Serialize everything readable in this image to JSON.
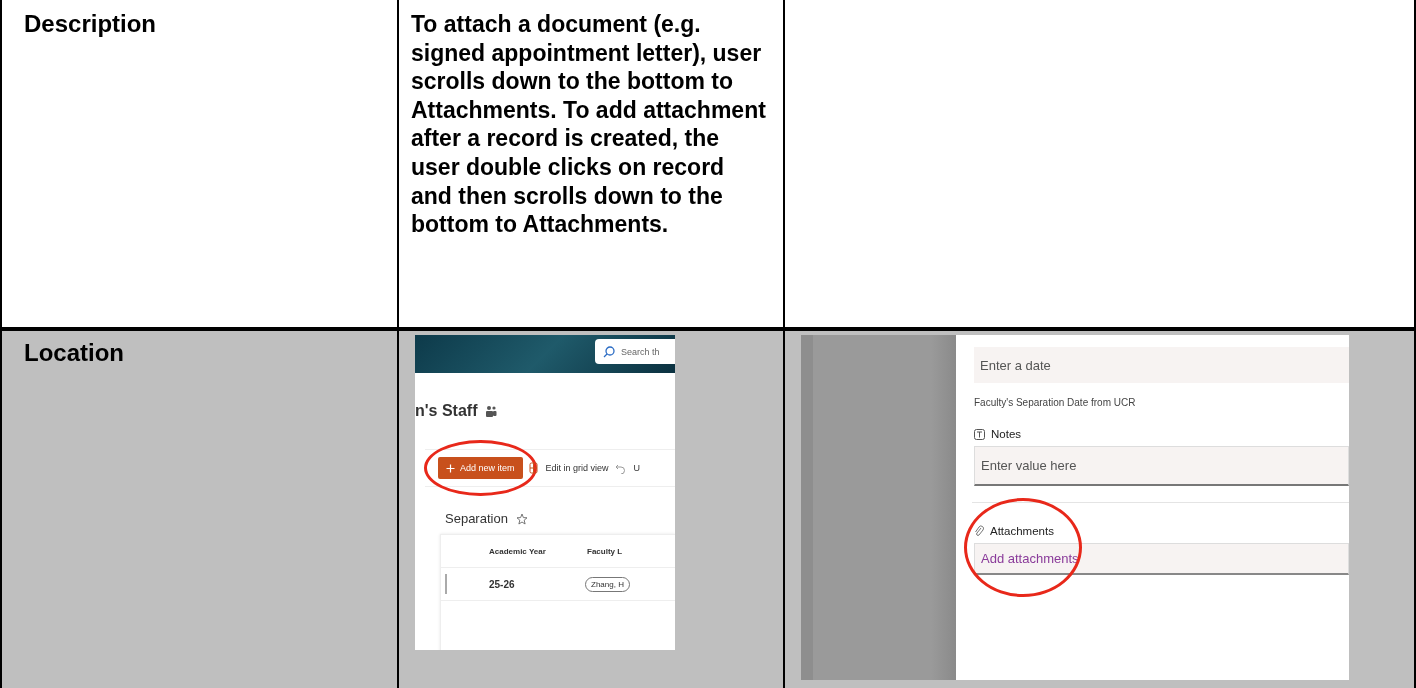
{
  "table": {
    "rows": [
      {
        "label": "Description",
        "text": "To attach a document (e.g. signed appointment letter), user scrolls down to the bottom to Attachments. To add attachment after a record is created, the user double clicks on record and then scrolls down to the bottom to Attachments."
      },
      {
        "label": "Location",
        "screenshots": [
          {
            "kind": "list-view",
            "search_placeholder": "Search th",
            "site_title": "n's Staff",
            "toolbar": [
              {
                "kind": "primary",
                "label": "Add new item",
                "circled": true
              },
              {
                "kind": "grid",
                "label": "Edit in grid view",
                "circled": false
              },
              {
                "kind": "undo",
                "label": "U",
                "circled": false
              }
            ],
            "list_title": "Separation",
            "columns": [
              "Academic Year",
              "Faculty L"
            ],
            "rows": [
              [
                "25-26",
                "Zhang, H"
              ]
            ]
          },
          {
            "kind": "form",
            "fields": [
              {
                "kind": "date",
                "placeholder": "Enter a date",
                "caption": "Faculty's Separation Date from UCR",
                "circled": false
              },
              {
                "kind": "text",
                "label": "Notes",
                "placeholder": "Enter value here",
                "circled": false
              },
              {
                "kind": "attachments",
                "label": "Attachments",
                "action": "Add attachments",
                "circled": true
              }
            ]
          }
        ]
      }
    ]
  }
}
